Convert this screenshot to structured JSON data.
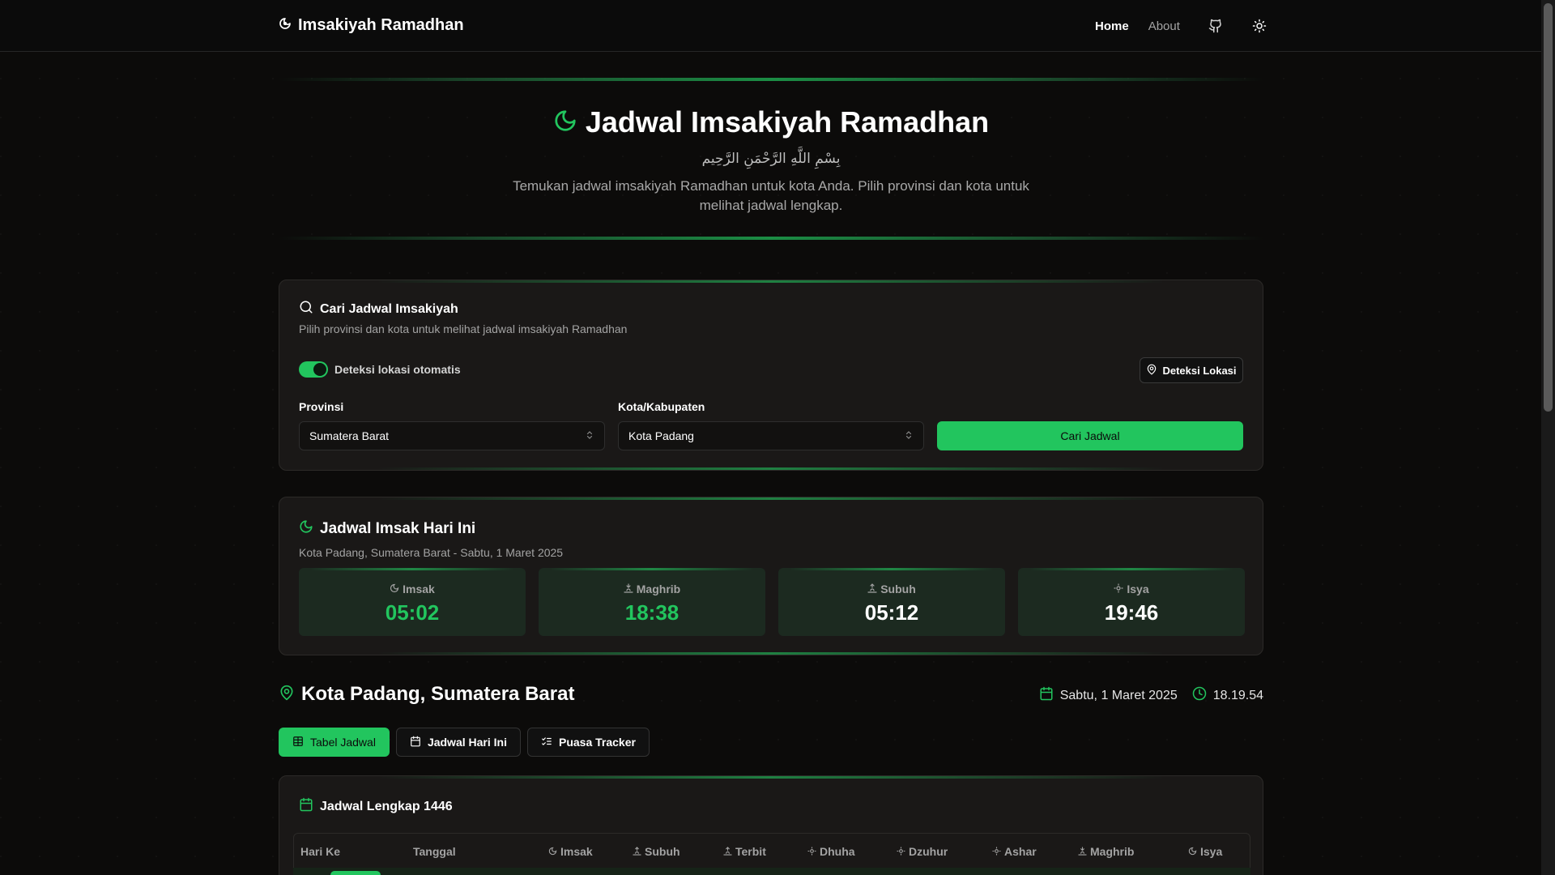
{
  "nav": {
    "brand": "Imsakiyah Ramadhan",
    "links": [
      "Home",
      "About"
    ]
  },
  "hero": {
    "title": "Jadwal Imsakiyah Ramadhan",
    "arabic": "بِسْمِ اللَّهِ الرَّحْمَنِ الرَّحِيم",
    "description": "Temukan jadwal imsakiyah Ramadhan untuk kota Anda. Pilih provinsi dan kota untuk melihat jadwal lengkap."
  },
  "search": {
    "title": "Cari Jadwal Imsakiyah",
    "subtitle": "Pilih provinsi dan kota untuk melihat jadwal imsakiyah Ramadhan",
    "toggle_label": "Deteksi lokasi otomatis",
    "detect_button": "Deteksi Lokasi",
    "province_label": "Provinsi",
    "province_value": "Sumatera Barat",
    "city_label": "Kota/Kabupaten",
    "city_value": "Kota Padang",
    "search_button": "Cari Jadwal"
  },
  "today": {
    "title": "Jadwal Imsak Hari Ini",
    "subtitle": "Kota Padang, Sumatera Barat - Sabtu, 1 Maret 2025",
    "times": [
      {
        "label": "Imsak",
        "value": "05:02"
      },
      {
        "label": "Maghrib",
        "value": "18:38"
      },
      {
        "label": "Subuh",
        "value": "05:12"
      },
      {
        "label": "Isya",
        "value": "19:46"
      }
    ]
  },
  "location": {
    "name": "Kota Padang, Sumatera Barat",
    "date": "Sabtu, 1 Maret 2025",
    "clock": "18.19.54"
  },
  "tabs": [
    "Tabel Jadwal",
    "Jadwal Hari Ini",
    "Puasa Tracker"
  ],
  "table": {
    "title": "Jadwal Lengkap 1446",
    "headers": [
      "Hari Ke",
      "Tanggal",
      "Imsak",
      "Subuh",
      "Terbit",
      "Dhuha",
      "Dzuhur",
      "Ashar",
      "Maghrib",
      "Isya"
    ]
  },
  "colors": {
    "accent": "#22c55e",
    "background": "#0c0b0a",
    "card": "#1a1817"
  }
}
